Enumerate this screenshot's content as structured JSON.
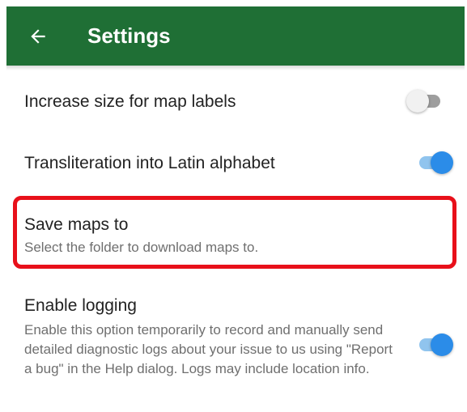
{
  "appbar": {
    "back_icon": "arrow-left-icon",
    "title": "Settings",
    "background_color": "#1f6f35"
  },
  "settings": [
    {
      "title": "Increase size for map labels",
      "toggle": "off"
    },
    {
      "title": "Transliteration into Latin alphabet",
      "toggle": "on"
    },
    {
      "title": "Save maps to",
      "summary": "Select the folder to download maps to."
    },
    {
      "title": "Enable logging",
      "summary": "Enable this option temporarily to record and manually send detailed diagnostic logs about your issue to us using \"Report a bug\" in the Help dialog. Logs may include location info.",
      "toggle": "on"
    }
  ],
  "highlight_color": "#e8101a",
  "toggle_on_color": "#2b8ce8"
}
